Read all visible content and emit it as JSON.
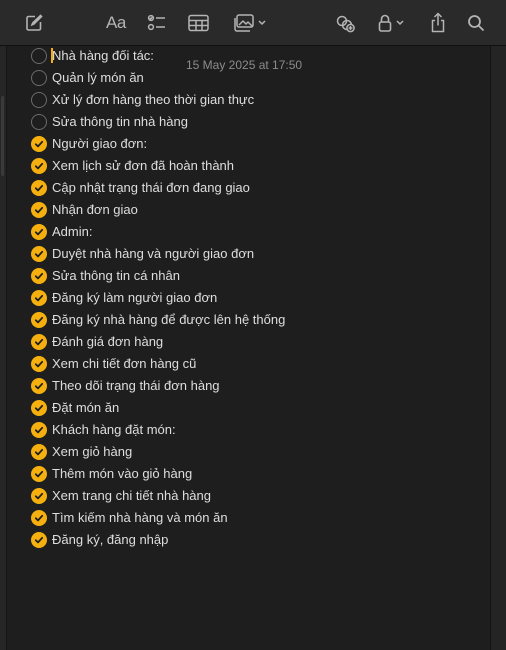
{
  "toolbar": {
    "format_label": "Aa",
    "items": [
      {
        "name": "compose-icon"
      },
      {
        "name": "format-text-button"
      },
      {
        "name": "checklist-icon"
      },
      {
        "name": "table-icon"
      },
      {
        "name": "media-icon"
      },
      {
        "name": "collaborate-icon"
      },
      {
        "name": "lock-icon"
      },
      {
        "name": "share-icon"
      },
      {
        "name": "search-icon"
      }
    ]
  },
  "note": {
    "timestamp": "15 May 2025 at 17:50",
    "accent_color": "#f5b00f",
    "checklist": [
      {
        "text": "Nhà hàng đối tác:",
        "checked": false
      },
      {
        "text": "Quản lý món ăn",
        "checked": false
      },
      {
        "text": "Xử lý đơn hàng theo thời gian thực",
        "checked": false
      },
      {
        "text": "Sửa thông tin nhà hàng",
        "checked": false
      },
      {
        "text": "Người giao đơn:",
        "checked": true
      },
      {
        "text": "Xem lịch sử đơn đã hoàn thành",
        "checked": true
      },
      {
        "text": "Cập nhật trạng thái đơn đang giao",
        "checked": true
      },
      {
        "text": "Nhận đơn giao",
        "checked": true
      },
      {
        "text": "Admin:",
        "checked": true
      },
      {
        "text": "Duyệt nhà hàng và người giao đơn",
        "checked": true
      },
      {
        "text": "Sửa thông tin cá nhân",
        "checked": true
      },
      {
        "text": "Đăng ký làm người giao đơn",
        "checked": true
      },
      {
        "text": "Đăng ký nhà hàng để được lên hệ thống",
        "checked": true
      },
      {
        "text": "Đánh giá đơn hàng",
        "checked": true
      },
      {
        "text": "Xem chi tiết đơn hàng cũ",
        "checked": true
      },
      {
        "text": "Theo dõi trạng thái đơn hàng",
        "checked": true
      },
      {
        "text": "Đặt món ăn",
        "checked": true
      },
      {
        "text": "Khách hàng đặt món:",
        "checked": true
      },
      {
        "text": "Xem giỏ hàng",
        "checked": true
      },
      {
        "text": "Thêm món vào giỏ hàng",
        "checked": true
      },
      {
        "text": "Xem trang chi tiết nhà hàng",
        "checked": true
      },
      {
        "text": "Tìm kiếm nhà hàng và món ăn",
        "checked": true
      },
      {
        "text": "Đăng ký, đăng nhập",
        "checked": true
      }
    ]
  }
}
